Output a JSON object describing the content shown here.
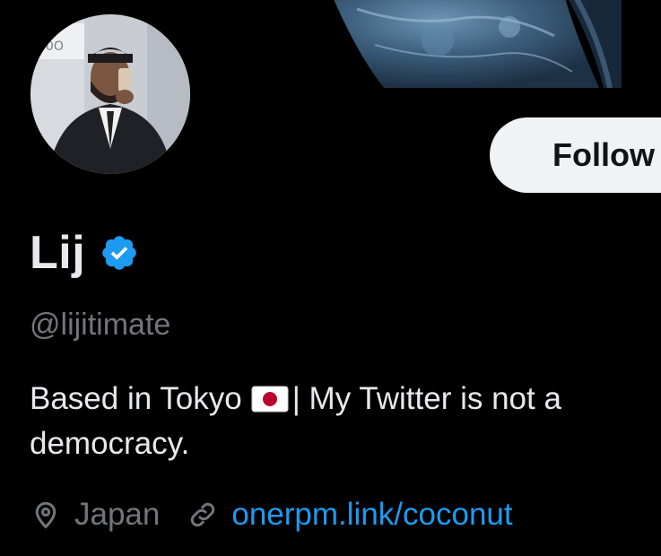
{
  "profile": {
    "display_name": "Lij",
    "handle": "@lijitimate",
    "bio_before_flag": "Based in Tokyo",
    "bio_after_flag": "| My Twitter is not a democracy.",
    "location": "Japan",
    "website": "onerpm.link/coconut"
  },
  "actions": {
    "follow_label": "Follow"
  },
  "icons": {
    "verified": "verified-badge-icon",
    "flag": "japan-flag-icon",
    "location": "location-pin-icon",
    "link": "link-icon"
  },
  "colors": {
    "background": "#000000",
    "primary_text": "#e7e9ea",
    "secondary_text": "#71767b",
    "link": "#1d9bf0",
    "verified": "#1d9bf0",
    "follow_button_bg": "#eff3f4"
  }
}
